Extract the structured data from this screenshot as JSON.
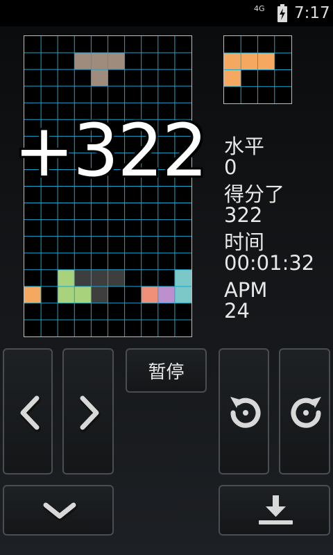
{
  "status_bar": {
    "network": "4G",
    "time": "7:17",
    "battery_icon": "battery-charging-icon"
  },
  "score_popup": "+322",
  "stats": {
    "level_label": "水平",
    "level_value": "0",
    "score_label": "得分了",
    "score_value": "322",
    "time_label": "时间",
    "time_value": "00:01:32",
    "apm_label": "APM",
    "apm_value": "24"
  },
  "controls": {
    "pause_label": "暂停",
    "left_icon": "chevron-left-icon",
    "right_icon": "chevron-right-icon",
    "rotate_ccw_icon": "rotate-counterclockwise-icon",
    "rotate_cw_icon": "rotate-clockwise-icon",
    "soft_drop_icon": "chevron-down-icon",
    "hard_drop_icon": "hard-drop-icon"
  },
  "colors": {
    "grid_line": "#1aa6cf",
    "board_bg": "#000000",
    "falling_piece": "#a08c7c",
    "next_piece": "#f5a860"
  },
  "board": {
    "columns": 10,
    "rows": 18,
    "falling_cells": [
      [
        3,
        1
      ],
      [
        4,
        1
      ],
      [
        5,
        1
      ],
      [
        4,
        2
      ]
    ],
    "locked_cells": [
      {
        "c": 2,
        "r": 14,
        "color": "#a8d27c"
      },
      {
        "c": 3,
        "r": 14,
        "color": "#3e3e3e"
      },
      {
        "c": 4,
        "r": 14,
        "color": "#3e3e3e"
      },
      {
        "c": 5,
        "r": 14,
        "color": "#3e3e3e"
      },
      {
        "c": 9,
        "r": 14,
        "color": "#7cc8c8"
      },
      {
        "c": 0,
        "r": 15,
        "color": "#f5a860"
      },
      {
        "c": 2,
        "r": 15,
        "color": "#a8d27c"
      },
      {
        "c": 3,
        "r": 15,
        "color": "#a8d27c"
      },
      {
        "c": 4,
        "r": 15,
        "color": "#3e3e3e"
      },
      {
        "c": 7,
        "r": 15,
        "color": "#f09078"
      },
      {
        "c": 8,
        "r": 15,
        "color": "#bb90cc"
      },
      {
        "c": 9,
        "r": 15,
        "color": "#7cc8c8"
      }
    ]
  },
  "next_preview": {
    "columns": 4,
    "rows": 4,
    "cells": [
      [
        0,
        1
      ],
      [
        1,
        1
      ],
      [
        2,
        1
      ],
      [
        0,
        2
      ]
    ]
  }
}
